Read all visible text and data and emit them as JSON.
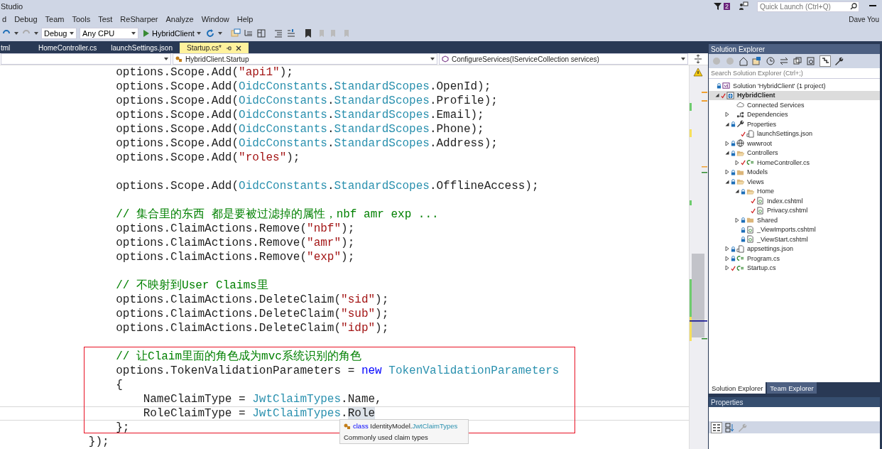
{
  "window": {
    "title": "Studio",
    "notifications": "2",
    "user": "Dave You",
    "quick_launch": {
      "placeholder": "Quick Launch (Ctrl+Q)"
    }
  },
  "menu": [
    "d",
    "Debug",
    "Team",
    "Tools",
    "Test",
    "ReSharper",
    "Analyze",
    "Window",
    "Help"
  ],
  "toolbar": {
    "configuration": "Debug",
    "platform": "Any CPU",
    "start": "HybridClient"
  },
  "tabs": [
    {
      "label": "tml",
      "selected": false
    },
    {
      "label": "HomeController.cs",
      "selected": false
    },
    {
      "label": "launchSettings.json",
      "selected": false
    },
    {
      "label": "Startup.cs*",
      "selected": true
    }
  ],
  "navigation": {
    "type": "HybridClient.Startup",
    "member": "ConfigureServices(IServiceCollection services)"
  },
  "code": {
    "lines": [
      {
        "kind": "code",
        "boxed": false,
        "current": false,
        "tokens": [
          {
            "kind": "plain",
            "text": "            options.Scope.Add("
          },
          {
            "kind": "string",
            "text": "\"api1\""
          },
          {
            "kind": "plain",
            "text": ");"
          }
        ]
      },
      {
        "kind": "code",
        "boxed": false,
        "current": false,
        "tokens": [
          {
            "kind": "plain",
            "text": "            options.Scope.Add("
          },
          {
            "kind": "type",
            "text": "OidcConstants"
          },
          {
            "kind": "plain",
            "text": "."
          },
          {
            "kind": "type",
            "text": "StandardScopes"
          },
          {
            "kind": "plain",
            "text": ".OpenId);"
          }
        ]
      },
      {
        "kind": "code",
        "boxed": false,
        "current": false,
        "tokens": [
          {
            "kind": "plain",
            "text": "            options.Scope.Add("
          },
          {
            "kind": "type",
            "text": "OidcConstants"
          },
          {
            "kind": "plain",
            "text": "."
          },
          {
            "kind": "type",
            "text": "StandardScopes"
          },
          {
            "kind": "plain",
            "text": ".Profile);"
          }
        ]
      },
      {
        "kind": "code",
        "boxed": false,
        "current": false,
        "tokens": [
          {
            "kind": "plain",
            "text": "            options.Scope.Add("
          },
          {
            "kind": "type",
            "text": "OidcConstants"
          },
          {
            "kind": "plain",
            "text": "."
          },
          {
            "kind": "type",
            "text": "StandardScopes"
          },
          {
            "kind": "plain",
            "text": ".Email);"
          }
        ]
      },
      {
        "kind": "code",
        "boxed": false,
        "current": false,
        "tokens": [
          {
            "kind": "plain",
            "text": "            options.Scope.Add("
          },
          {
            "kind": "type",
            "text": "OidcConstants"
          },
          {
            "kind": "plain",
            "text": "."
          },
          {
            "kind": "type",
            "text": "StandardScopes"
          },
          {
            "kind": "plain",
            "text": ".Phone);"
          }
        ]
      },
      {
        "kind": "code",
        "boxed": false,
        "current": false,
        "tokens": [
          {
            "kind": "plain",
            "text": "            options.Scope.Add("
          },
          {
            "kind": "type",
            "text": "OidcConstants"
          },
          {
            "kind": "plain",
            "text": "."
          },
          {
            "kind": "type",
            "text": "StandardScopes"
          },
          {
            "kind": "plain",
            "text": ".Address);"
          }
        ]
      },
      {
        "kind": "code",
        "boxed": false,
        "current": false,
        "tokens": [
          {
            "kind": "plain",
            "text": "            options.Scope.Add("
          },
          {
            "kind": "string",
            "text": "\"roles\""
          },
          {
            "kind": "plain",
            "text": ");"
          }
        ]
      },
      {
        "kind": "blank",
        "boxed": false,
        "current": false
      },
      {
        "kind": "code",
        "boxed": false,
        "current": false,
        "tokens": [
          {
            "kind": "plain",
            "text": "            options.Scope.Add("
          },
          {
            "kind": "type",
            "text": "OidcConstants"
          },
          {
            "kind": "plain",
            "text": "."
          },
          {
            "kind": "type",
            "text": "StandardScopes"
          },
          {
            "kind": "plain",
            "text": ".OfflineAccess);"
          }
        ]
      },
      {
        "kind": "blank",
        "boxed": false,
        "current": false
      },
      {
        "kind": "code",
        "boxed": false,
        "current": false,
        "tokens": [
          {
            "kind": "comment",
            "text": "            // 集合里的东西 都是要被过滤掉的属性，nbf amr exp ..."
          }
        ]
      },
      {
        "kind": "code",
        "boxed": false,
        "current": false,
        "tokens": [
          {
            "kind": "plain",
            "text": "            options.ClaimActions.Remove("
          },
          {
            "kind": "string",
            "text": "\"nbf\""
          },
          {
            "kind": "plain",
            "text": ");"
          }
        ]
      },
      {
        "kind": "code",
        "boxed": false,
        "current": false,
        "tokens": [
          {
            "kind": "plain",
            "text": "            options.ClaimActions.Remove("
          },
          {
            "kind": "string",
            "text": "\"amr\""
          },
          {
            "kind": "plain",
            "text": ");"
          }
        ]
      },
      {
        "kind": "code",
        "boxed": false,
        "current": false,
        "tokens": [
          {
            "kind": "plain",
            "text": "            options.ClaimActions.Remove("
          },
          {
            "kind": "string",
            "text": "\"exp\""
          },
          {
            "kind": "plain",
            "text": ");"
          }
        ]
      },
      {
        "kind": "blank",
        "boxed": false,
        "current": false
      },
      {
        "kind": "code",
        "boxed": false,
        "current": false,
        "tokens": [
          {
            "kind": "comment",
            "text": "            // 不映射到User Claims里"
          }
        ]
      },
      {
        "kind": "code",
        "boxed": false,
        "current": false,
        "tokens": [
          {
            "kind": "plain",
            "text": "            options.ClaimActions.DeleteClaim("
          },
          {
            "kind": "string",
            "text": "\"sid\""
          },
          {
            "kind": "plain",
            "text": ");"
          }
        ]
      },
      {
        "kind": "code",
        "boxed": false,
        "current": false,
        "tokens": [
          {
            "kind": "plain",
            "text": "            options.ClaimActions.DeleteClaim("
          },
          {
            "kind": "string",
            "text": "\"sub\""
          },
          {
            "kind": "plain",
            "text": ");"
          }
        ]
      },
      {
        "kind": "code",
        "boxed": false,
        "current": false,
        "tokens": [
          {
            "kind": "plain",
            "text": "            options.ClaimActions.DeleteClaim("
          },
          {
            "kind": "string",
            "text": "\"idp\""
          },
          {
            "kind": "plain",
            "text": ");"
          }
        ]
      },
      {
        "kind": "blank",
        "boxed": false,
        "current": false
      },
      {
        "kind": "code",
        "boxed": true,
        "current": false,
        "tokens": [
          {
            "kind": "comment",
            "text": "            // 让Claim里面的角色成为mvc系统识别的角色"
          }
        ]
      },
      {
        "kind": "code",
        "boxed": true,
        "current": false,
        "tokens": [
          {
            "kind": "plain",
            "text": "            options.TokenValidationParameters = "
          },
          {
            "kind": "keyword",
            "text": "new"
          },
          {
            "kind": "type",
            "text": " TokenValidationParameters"
          }
        ]
      },
      {
        "kind": "code",
        "boxed": true,
        "current": false,
        "tokens": [
          {
            "kind": "plain",
            "text": "            {"
          }
        ]
      },
      {
        "kind": "code",
        "boxed": true,
        "current": false,
        "tokens": [
          {
            "kind": "plain",
            "text": "                NameClaimType = "
          },
          {
            "kind": "type",
            "text": "JwtClaimTypes"
          },
          {
            "kind": "plain",
            "text": ".Name,"
          }
        ]
      },
      {
        "kind": "code",
        "boxed": true,
        "current": true,
        "tokens": [
          {
            "kind": "plain",
            "text": "                RoleClaimType = "
          },
          {
            "kind": "type",
            "text": "JwtClaimTypes"
          },
          {
            "kind": "plain",
            "text": "."
          },
          {
            "kind": "match",
            "text": "Role"
          }
        ]
      },
      {
        "kind": "code",
        "boxed": true,
        "current": false,
        "tokens": [
          {
            "kind": "plain",
            "text": "            };"
          }
        ]
      },
      {
        "kind": "code",
        "boxed": false,
        "current": false,
        "tokens": [
          {
            "kind": "plain",
            "text": "        });"
          }
        ]
      }
    ]
  },
  "tooltip": {
    "signature": [
      {
        "kind": "keyword",
        "text": "class"
      },
      {
        "kind": "plain",
        "text": " IdentityModel."
      },
      {
        "kind": "type",
        "text": "JwtClaimTypes"
      }
    ],
    "description": "Commonly used claim types"
  },
  "solution_explorer": {
    "title": "Solution Explorer",
    "search": {
      "placeholder": "Search Solution Explorer (Ctrl+;)"
    },
    "tree": [
      {
        "label": "Solution 'HybridClient' (1 project)",
        "kind": "solution",
        "locked": true,
        "modified": false,
        "selected": false,
        "children": [
          {
            "label": "HybridClient",
            "kind": "project",
            "locked": false,
            "modified": true,
            "expanded": true,
            "selected": true,
            "children": [
              {
                "label": "Connected Services",
                "kind": "cloud",
                "locked": false,
                "modified": false,
                "selected": false
              },
              {
                "label": "Dependencies",
                "kind": "dependencies",
                "locked": false,
                "modified": false,
                "expanded": false,
                "selected": false
              },
              {
                "label": "Properties",
                "kind": "wrench",
                "locked": true,
                "modified": false,
                "expanded": true,
                "selected": false,
                "children": [
                  {
                    "label": "launchSettings.json",
                    "kind": "json",
                    "locked": false,
                    "modified": true,
                    "selected": false
                  }
                ]
              },
              {
                "label": "wwwroot",
                "kind": "globe",
                "locked": true,
                "modified": false,
                "expanded": false,
                "selected": false
              },
              {
                "label": "Controllers",
                "kind": "folder",
                "locked": true,
                "modified": false,
                "expanded": true,
                "selected": false,
                "children": [
                  {
                    "label": "HomeController.cs",
                    "kind": "csharp",
                    "locked": false,
                    "modified": true,
                    "expanded": false,
                    "selected": false
                  }
                ]
              },
              {
                "label": "Models",
                "kind": "folder",
                "locked": true,
                "modified": false,
                "expanded": false,
                "selected": false
              },
              {
                "label": "Views",
                "kind": "folder",
                "locked": true,
                "modified": false,
                "expanded": true,
                "selected": false,
                "children": [
                  {
                    "label": "Home",
                    "kind": "folder",
                    "locked": true,
                    "modified": false,
                    "expanded": true,
                    "selected": false,
                    "children": [
                      {
                        "label": "Index.cshtml",
                        "kind": "cshtml",
                        "locked": false,
                        "modified": true,
                        "selected": false
                      },
                      {
                        "label": "Privacy.cshtml",
                        "kind": "cshtml",
                        "locked": false,
                        "modified": true,
                        "selected": false
                      }
                    ]
                  },
                  {
                    "label": "Shared",
                    "kind": "folder",
                    "locked": true,
                    "modified": false,
                    "expanded": false,
                    "selected": false
                  },
                  {
                    "label": "_ViewImports.cshtml",
                    "kind": "cshtml",
                    "locked": true,
                    "modified": false,
                    "selected": false
                  },
                  {
                    "label": "_ViewStart.cshtml",
                    "kind": "cshtml",
                    "locked": true,
                    "modified": false,
                    "selected": false
                  }
                ]
              },
              {
                "label": "appsettings.json",
                "kind": "json",
                "locked": true,
                "modified": false,
                "expanded": false,
                "selected": false
              },
              {
                "label": "Program.cs",
                "kind": "csharp",
                "locked": true,
                "modified": false,
                "expanded": false,
                "selected": false
              },
              {
                "label": "Startup.cs",
                "kind": "csharp",
                "locked": false,
                "modified": true,
                "expanded": false,
                "selected": false
              }
            ]
          }
        ]
      }
    ]
  },
  "panel_tabs": [
    {
      "label": "Solution Explorer",
      "selected": true
    },
    {
      "label": "Team Explorer",
      "selected": false
    }
  ],
  "properties": {
    "title": "Properties"
  }
}
